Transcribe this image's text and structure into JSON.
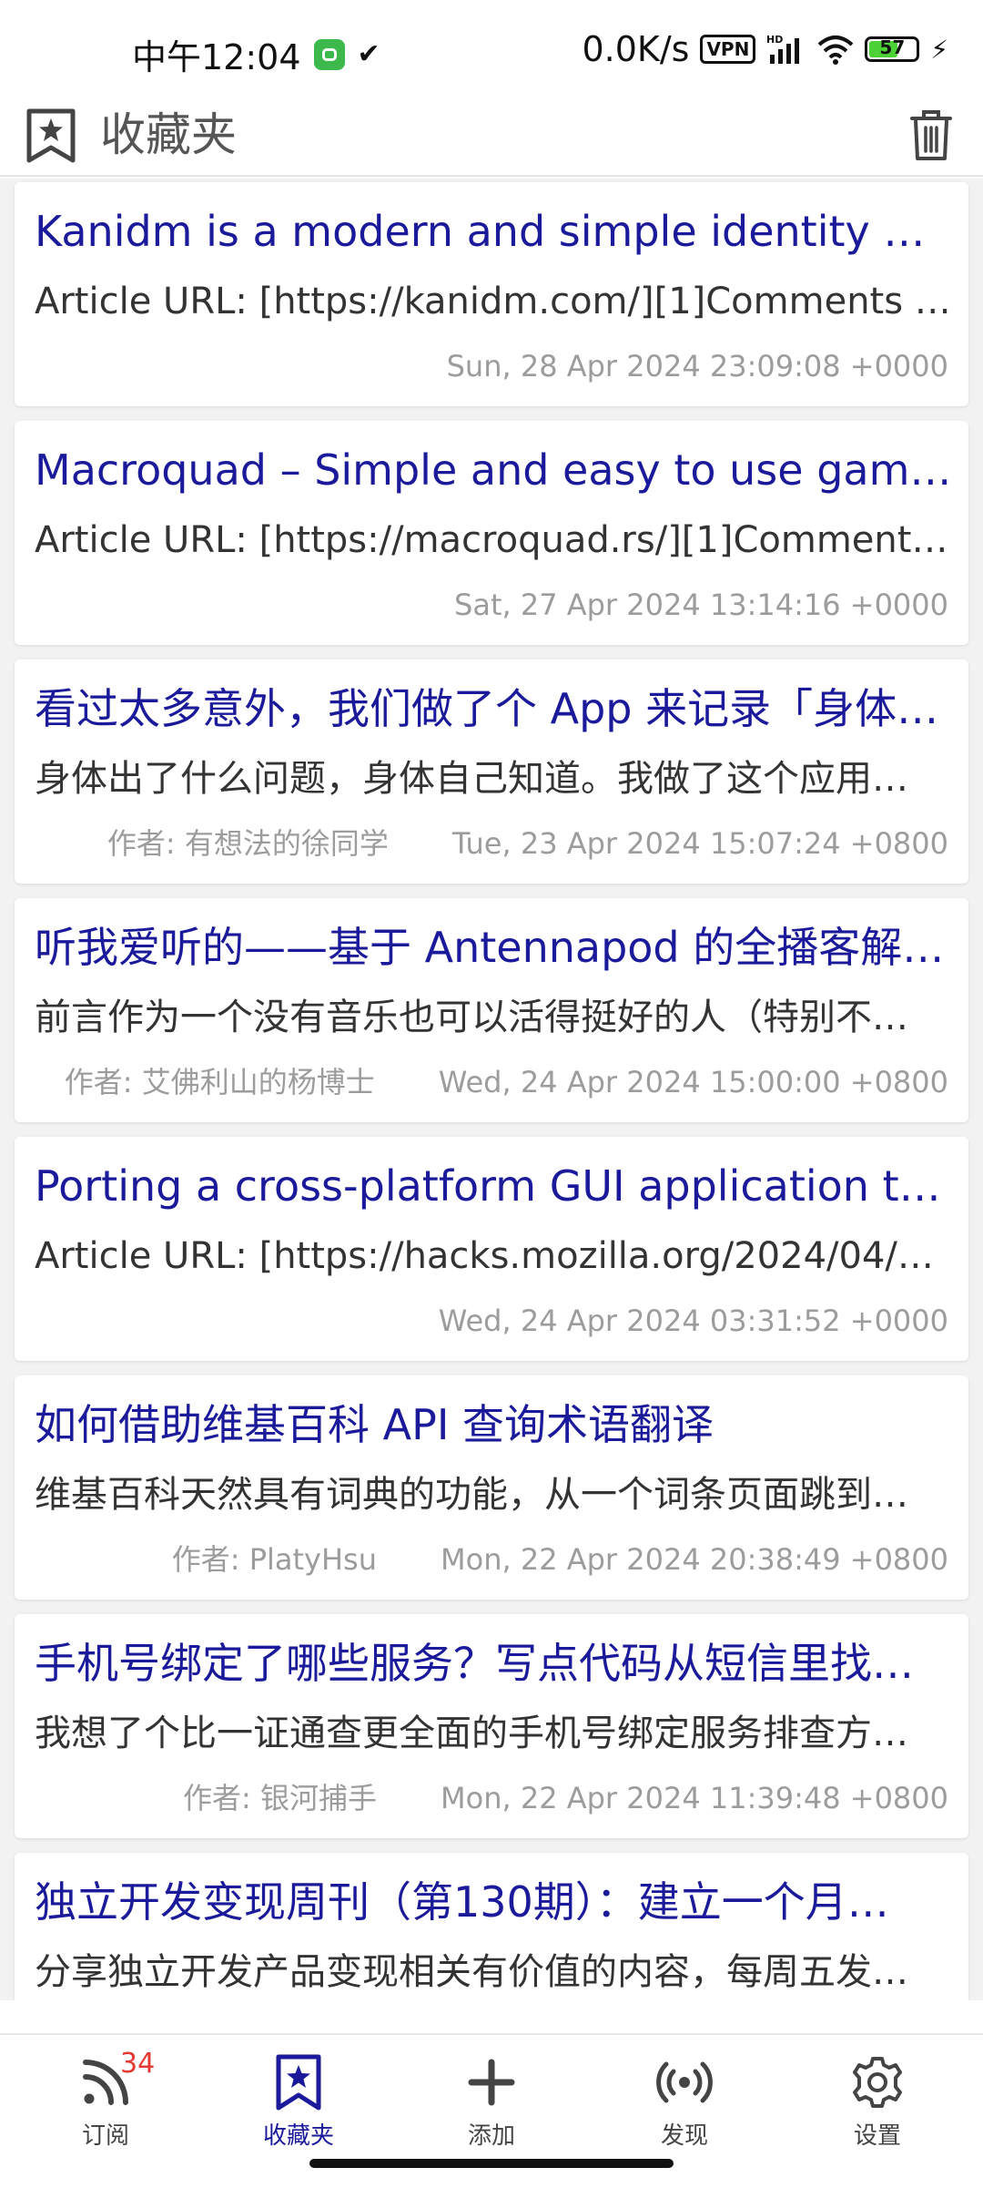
{
  "status_bar": {
    "time": "中午12:04",
    "net_speed": "0.0K/s",
    "vpn": "VPN",
    "battery": "57"
  },
  "header": {
    "title": "收藏夹"
  },
  "items": [
    {
      "title": "Kanidm is a modern and simple identity ma…",
      "summary": "Article URL: [https://kanidm.com/][1]Comments U…",
      "author": "",
      "date": "Sun, 28 Apr 2024 23:09:08 +0000"
    },
    {
      "title": "Macroquad – Simple and easy to use game l…",
      "summary": "Article URL: [https://macroquad.rs/][1]Comments …",
      "author": "",
      "date": "Sat, 27 Apr 2024 13:14:16 +0000"
    },
    {
      "title": "看过太多意外，我们做了个 App 来记录「身体…",
      "summary": "身体出了什么问题，身体自己知道。我做了这个应用…",
      "author": "作者: 有想法的徐同学",
      "date": "Tue, 23 Apr 2024 15:07:24 +0800"
    },
    {
      "title": "听我爱听的——基于 Antennapod 的全播客解…",
      "summary": "前言作为一个没有音乐也可以活得挺好的人（特别不…",
      "author": "作者: 艾佛利山的杨博士",
      "date": "Wed, 24 Apr 2024 15:00:00 +0800"
    },
    {
      "title": "Porting a cross-platform GUI application to …",
      "summary": "Article URL: [https://hacks.mozilla.org/2024/04/po…",
      "author": "",
      "date": "Wed, 24 Apr 2024 03:31:52 +0000"
    },
    {
      "title": "如何借助维基百科 API 查询术语翻译",
      "summary": "维基百科天然具有词典的功能，从一个词条页面跳到…",
      "author": "作者: PlatyHsu",
      "date": "Mon, 22 Apr 2024 20:38:49 +0800"
    },
    {
      "title": "手机号绑定了哪些服务？写点代码从短信里找…",
      "summary": "我想了个比一证通查更全面的手机号绑定服务排查方…",
      "author": "作者: 银河捕手",
      "date": "Mon, 22 Apr 2024 11:39:48 +0800"
    },
    {
      "title": "独立开发变现周刊（第130期）：建立一个月…",
      "summary": "分享独立开发产品变现相关有价值的内容，每周五发…",
      "author": "",
      "date": ""
    }
  ],
  "nav": {
    "subscriptions": "订阅",
    "subscriptions_badge": "34",
    "favorites": "收藏夹",
    "add": "添加",
    "discover": "发现",
    "settings": "设置"
  },
  "colors": {
    "title_blue": "#1a1a9a",
    "badge_red": "#e53935",
    "meta_gray": "#9c9c9c"
  }
}
